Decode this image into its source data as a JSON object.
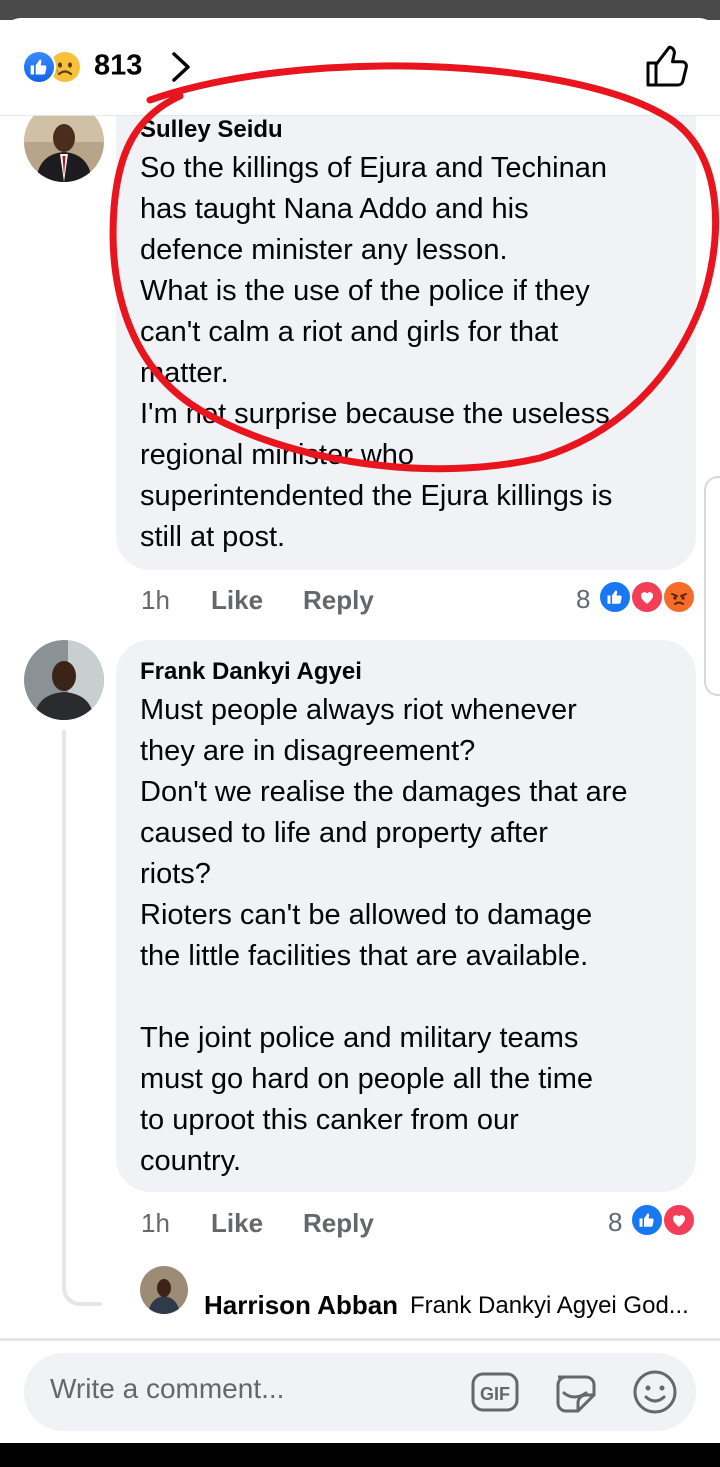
{
  "reactions": {
    "count": "813",
    "icons": [
      "like-icon",
      "sad-icon"
    ]
  },
  "comments": [
    {
      "author": "Sulley Seidu",
      "lines": [
        "So the killings of Ejura and Techinan",
        "has taught Nana Addo and his",
        "defence minister any lesson.",
        "What is the use of the police if they",
        "can't calm a riot and girls for that",
        "matter.",
        "I'm not surprise because the useless",
        "regional minister who",
        "superintendented the Ejura killings is",
        "still at post."
      ],
      "time": "1h",
      "like_label": "Like",
      "reply_label": "Reply",
      "reaction_count": "8",
      "reaction_icons": [
        "like-icon",
        "love-icon",
        "angry-icon"
      ]
    },
    {
      "author": "Frank Dankyi Agyei",
      "lines": [
        "Must people always riot whenever",
        "they are in disagreement?",
        "Don't we realise the damages that are",
        "caused to life and property after",
        "riots?",
        "Rioters can't be allowed to damage",
        "the little facilities that are available.",
        "",
        "The joint police and military teams",
        "must go hard on people all the time",
        "to uproot this canker from our",
        "country."
      ],
      "time": "1h",
      "like_label": "Like",
      "reply_label": "Reply",
      "reaction_count": "8",
      "reaction_icons": [
        "like-icon",
        "love-icon"
      ]
    }
  ],
  "reply_preview": {
    "author": "Harrison Abban",
    "text": "Frank Dankyi Agyei God..."
  },
  "composer": {
    "placeholder": "Write a comment...",
    "icons": [
      "gif-icon",
      "sticker-icon",
      "emoji-icon"
    ]
  },
  "colors": {
    "accent": "#1877f2",
    "bubble": "#f0f2f5",
    "muted": "#65676b",
    "annotation": "#e8141e"
  }
}
